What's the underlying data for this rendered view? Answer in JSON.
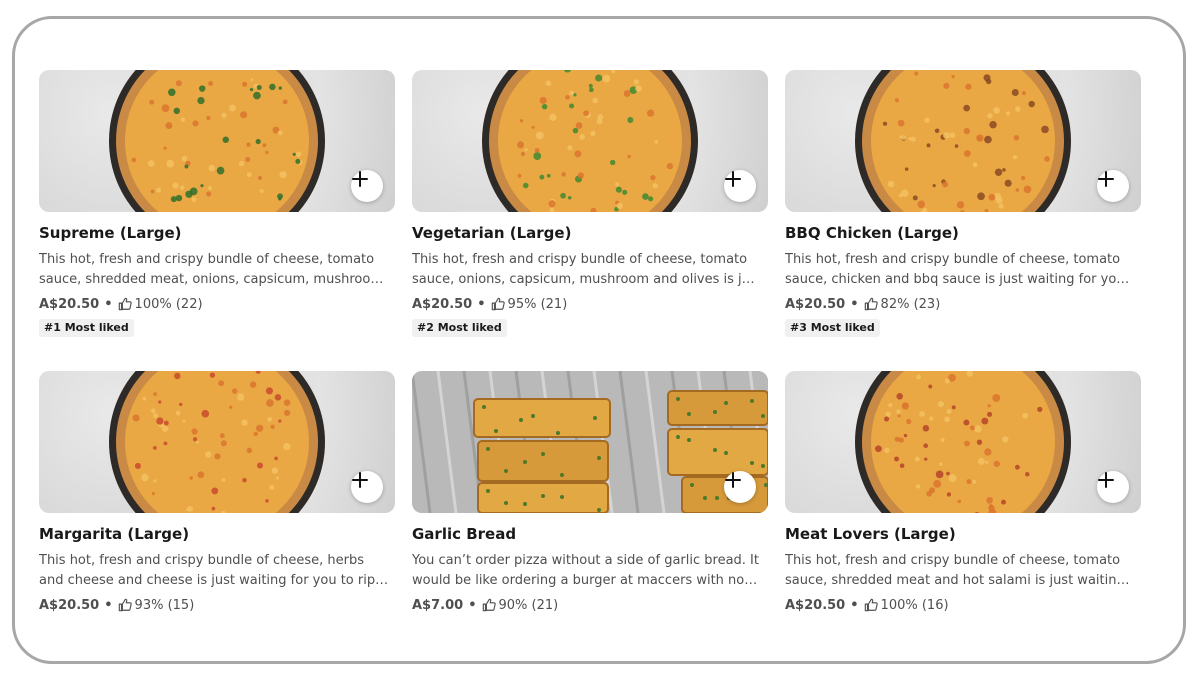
{
  "menu": {
    "items": [
      {
        "title": "Supreme (Large)",
        "description": "This hot, fresh and crispy bundle of cheese, tomato sauce, shredded meat, onions, capsicum, mushroom, olives and pineapple is just waiting for you to rip into it.",
        "price": "A$20.50",
        "rating": "100% (22)",
        "badge": "#1 Most liked",
        "image": "pizza",
        "topping_color": "#2f6f2a"
      },
      {
        "title": "Vegetarian (Large)",
        "description": "This hot, fresh and crispy bundle of cheese, tomato sauce, onions, capsicum, mushroom and olives is just waiting for you to rip into it.",
        "price": "A$20.50",
        "rating": "95% (21)",
        "badge": "#2 Most liked",
        "image": "pizza",
        "topping_color": "#3f8a2f"
      },
      {
        "title": "BBQ Chicken (Large)",
        "description": "This hot, fresh and crispy bundle of cheese, tomato sauce, chicken and bbq sauce is just waiting for you to rip into it.",
        "price": "A$20.50",
        "rating": "82% (23)",
        "badge": "#3 Most liked",
        "image": "pizza",
        "topping_color": "#8a4a22"
      },
      {
        "title": "Margarita (Large)",
        "description": "This hot, fresh and crispy bundle of cheese, herbs and cheese and cheese is just waiting for you to rip into it.",
        "price": "A$20.50",
        "rating": "93% (15)",
        "badge": "",
        "image": "pizza",
        "topping_color": "#c94a2c"
      },
      {
        "title": "Garlic Bread",
        "description": "You can’t order pizza without a side of garlic bread. It would be like ordering a burger at maccers with no fries.",
        "price": "A$7.00",
        "rating": "90% (21)",
        "badge": "",
        "image": "garlic-bread",
        "topping_color": "#4c7a2a"
      },
      {
        "title": "Meat Lovers (Large)",
        "description": "This hot, fresh and crispy bundle of cheese, tomato sauce, shredded meat and hot salami is just waiting for you to rip into it.",
        "price": "A$20.50",
        "rating": "100% (16)",
        "badge": "",
        "image": "pizza",
        "topping_color": "#b5452a"
      }
    ]
  },
  "icons": {
    "add": "plus-icon",
    "rating": "thumbs-up-icon"
  },
  "colors": {
    "frame_border": "#a7a7a7",
    "text_primary": "#191919",
    "text_secondary": "#4f4f4f",
    "badge_bg": "#f0f0f0"
  }
}
